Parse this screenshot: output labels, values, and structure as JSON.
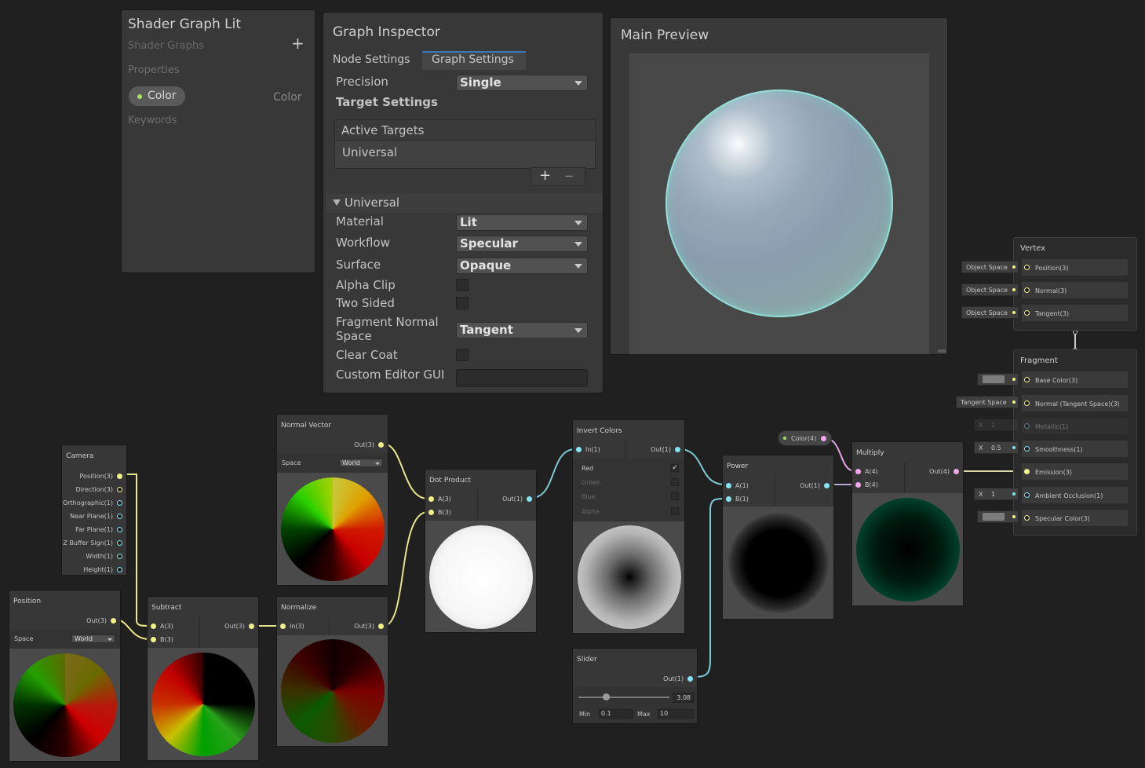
{
  "blackboard": {
    "title": "Shader Graph Lit",
    "subtitle": "Shader Graphs",
    "add": "+",
    "properties_label": "Properties",
    "property": {
      "name": "Color",
      "type": "Color"
    },
    "keywords_label": "Keywords"
  },
  "inspector": {
    "title": "Graph Inspector",
    "tabs": [
      "Node Settings",
      "Graph Settings"
    ],
    "active_tab": "Graph Settings",
    "precision": {
      "label": "Precision",
      "value": "Single"
    },
    "target_settings": "Target Settings",
    "active_targets": {
      "header": "Active Targets",
      "items": [
        "Universal"
      ],
      "add": "+",
      "remove": "−"
    },
    "section": "Universal",
    "rows": {
      "material": {
        "label": "Material",
        "value": "Lit"
      },
      "workflow": {
        "label": "Workflow",
        "value": "Specular"
      },
      "surface": {
        "label": "Surface",
        "value": "Opaque"
      },
      "alpha_clip": {
        "label": "Alpha Clip",
        "checked": false
      },
      "two_sided": {
        "label": "Two Sided",
        "checked": false
      },
      "fragment_normal_space": {
        "label": "Fragment Normal Space",
        "label_1": "Fragment Normal",
        "label_2": "Space",
        "value": "Tangent"
      },
      "clear_coat": {
        "label": "Clear Coat",
        "checked": false
      },
      "custom_editor_gui": {
        "label": "Custom Editor GUI",
        "value": ""
      }
    }
  },
  "preview": {
    "title": "Main Preview"
  },
  "nodes": {
    "camera": {
      "title": "Camera",
      "outputs": [
        "Position(3)",
        "Direction(3)",
        "Orthographic(1)",
        "Near Plane(1)",
        "Far Plane(1)",
        "Z Buffer Sign(1)",
        "Width(1)",
        "Height(1)"
      ]
    },
    "position": {
      "title": "Position",
      "output": "Out(3)",
      "space_label": "Space",
      "space_value": "World"
    },
    "subtract": {
      "title": "Subtract",
      "inputs": [
        "A(3)",
        "B(3)"
      ],
      "output": "Out(3)"
    },
    "normal_vector": {
      "title": "Normal Vector",
      "output": "Out(3)",
      "space_label": "Space",
      "space_value": "World"
    },
    "normalize": {
      "title": "Normalize",
      "input": "In(3)",
      "output": "Out(3)"
    },
    "dot_product": {
      "title": "Dot Product",
      "inputs": [
        "A(3)",
        "B(3)"
      ],
      "output": "Out(1)"
    },
    "invert_colors": {
      "title": "Invert Colors",
      "input": "In(1)",
      "output": "Out(1)",
      "channels": [
        {
          "label": "Red",
          "checked": true
        },
        {
          "label": "Green",
          "checked": false
        },
        {
          "label": "Blue",
          "checked": false
        },
        {
          "label": "Alpha",
          "checked": false
        }
      ]
    },
    "slider": {
      "title": "Slider",
      "output": "Out(1)",
      "value": "3.08",
      "min_label": "Min",
      "min": "0.1",
      "max_label": "Max",
      "max": "10",
      "fraction": 0.3
    },
    "power": {
      "title": "Power",
      "inputs": [
        "A(1)",
        "B(1)"
      ],
      "output": "Out(1)"
    },
    "color_property": {
      "label": "Color(4)"
    },
    "multiply": {
      "title": "Multiply",
      "inputs": [
        "A(4)",
        "B(4)"
      ],
      "output": "Out(4)"
    }
  },
  "vertex": {
    "title": "Vertex",
    "blocks": [
      {
        "input": "Object Space",
        "label": "Position(3)"
      },
      {
        "input": "Object Space",
        "label": "Normal(3)"
      },
      {
        "input": "Object Space",
        "label": "Tangent(3)"
      }
    ]
  },
  "fragment": {
    "title": "Fragment",
    "blocks": [
      {
        "input": "",
        "label": "Base Color(3)"
      },
      {
        "input": "Tangent Space",
        "label": "Normal (Tangent Space)(3)"
      },
      {
        "input_x": "X",
        "input_v": "1",
        "label": "Metallic(1)"
      },
      {
        "input_x": "X",
        "input_v": "0.5",
        "label": "Smoothness(1)"
      },
      {
        "input": "",
        "label": "Emission(3)"
      },
      {
        "input_x": "X",
        "input_v": "1",
        "label": "Ambient Occlusion(1)"
      },
      {
        "input": "",
        "label": "Specular Color(3)"
      }
    ]
  },
  "colors": {
    "accent": "#3a79bb",
    "vec3_port": "#f2f28a",
    "float_port": "#84e4f4",
    "vec4_port": "#f4a6ee"
  }
}
